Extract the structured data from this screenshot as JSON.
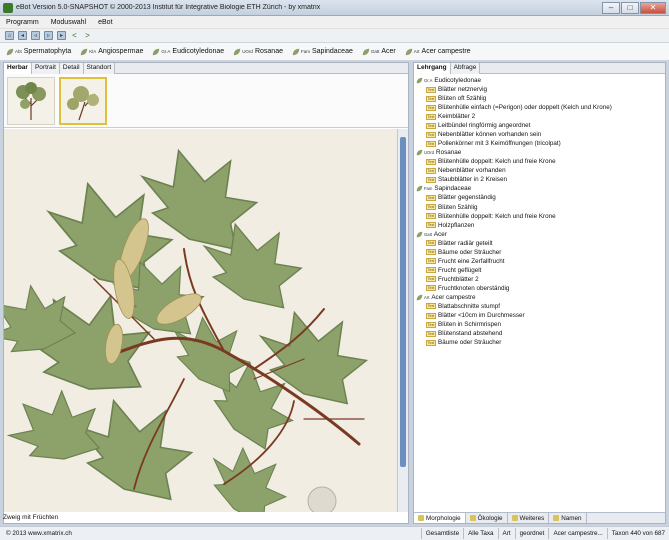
{
  "window": {
    "title": "eBot Version 5.0-SNAPSHOT © 2000-2013 Institut für Integrative Biologie ETH Zürich - by xmatrix"
  },
  "menu": [
    "Programm",
    "Moduswahl",
    "eBot"
  ],
  "breadcrumb": [
    {
      "rank": "Abt",
      "name": "Spermatophyta"
    },
    {
      "rank": "KlA",
      "name": "Angiospermae"
    },
    {
      "rank": "Gr.A",
      "name": "Eudicotyledonae"
    },
    {
      "rank": "UOrd",
      "name": "Rosanae"
    },
    {
      "rank": "Fam",
      "name": "Sapindaceae"
    },
    {
      "rank": "Gatt",
      "name": "Acer"
    },
    {
      "rank": "Art",
      "name": "Acer campestre"
    }
  ],
  "left_tabs": [
    "Herbar",
    "Portrait",
    "Detail",
    "Standort"
  ],
  "caption": "Zweig mit Früchten",
  "right_tabs": [
    "Lehrgang",
    "Abfrage"
  ],
  "trait_tag": "Text",
  "tree": [
    {
      "rank": "Gr.A",
      "name": "Eudicotyledonae",
      "traits": [
        "Blätter netznervig",
        "Blüten oft 5zählig",
        "Blütenhülle einfach (=Perigon) oder doppelt (Kelch und Krone)",
        "Keimblätter 2",
        "Leitbündel ringförmig angeordnet",
        "Nebenblätter können vorhanden sein",
        "Pollenkörner mit 3 Keimöffnungen (tricolpat)"
      ]
    },
    {
      "rank": "UOrd",
      "name": "Rosanae",
      "traits": [
        "Blütenhülle doppelt: Kelch und freie Krone",
        "Nebenblätter vorhanden",
        "Staubblätter in 2 Kreisen"
      ]
    },
    {
      "rank": "Fam",
      "name": "Sapindaceae",
      "traits": [
        "Blätter gegenständig",
        "Blüten 5zählig",
        "Blütenhülle doppelt: Kelch und freie Krone",
        "Holzpflanzen"
      ]
    },
    {
      "rank": "Gatt",
      "name": "Acer",
      "traits": [
        "Blätter radiär geteilt",
        "Bäume oder Sträucher",
        "Frucht eine Zerfallfrucht",
        "Frucht geflügelt",
        "Fruchtblätter 2",
        "Fruchtknoten oberständig"
      ]
    },
    {
      "rank": "Art",
      "name": "Acer campestre",
      "traits": [
        "Blattabschnitte stumpf",
        "Blätter <10cm im Durchmesser",
        "Blüten in Schirmrispen",
        "Blütenstand abstehend",
        "Bäume oder Sträucher"
      ]
    }
  ],
  "bottom_tabs": [
    "Morphologie",
    "Ökologie",
    "Weiteres",
    "Namen"
  ],
  "status": {
    "copyright": "© 2013 www.xmatrix.ch",
    "segments": [
      "Gesamtliste",
      "Alle Taxa",
      "Art",
      "geordnet",
      "Acer campestre...",
      "Taxon 440 von 687"
    ]
  },
  "colors": {
    "leaf_green": "#8aa067",
    "stem_brown": "#7a3a22",
    "accent_yellow": "#e0c23a",
    "scroll_blue": "#6d8fbf"
  }
}
